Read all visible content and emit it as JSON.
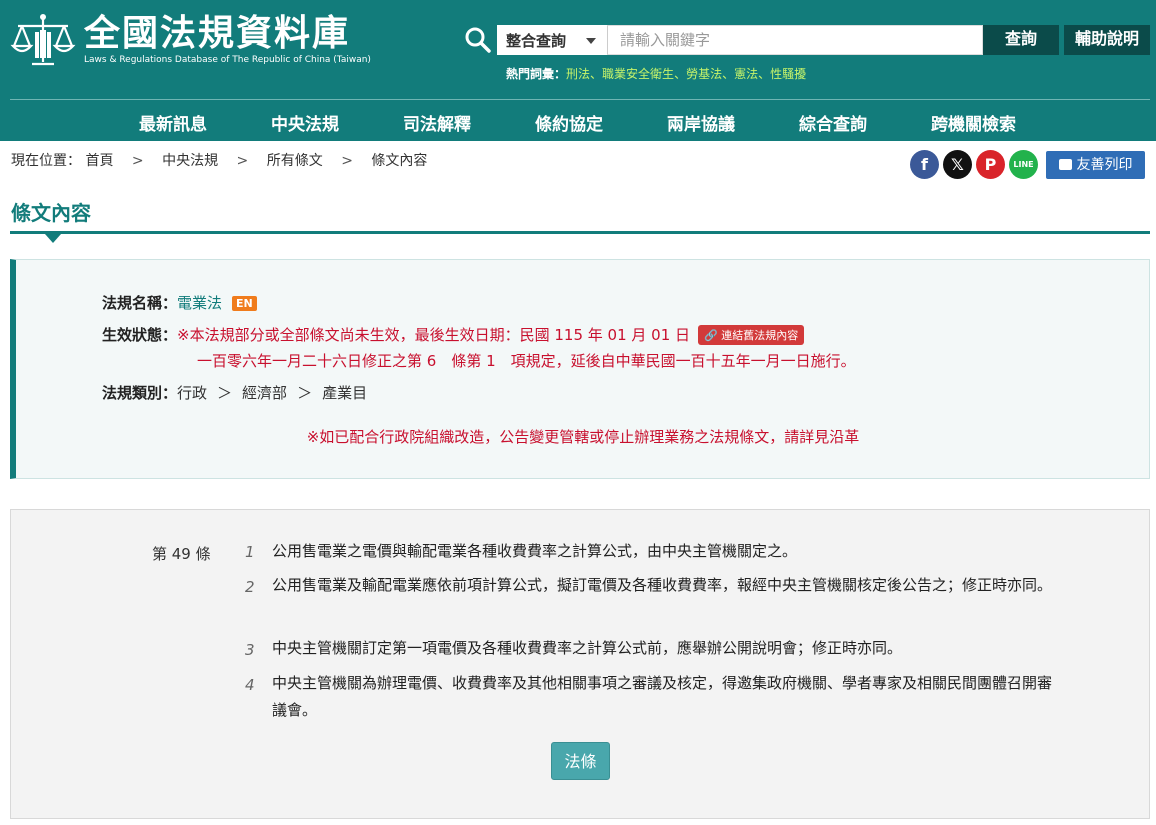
{
  "header": {
    "title": "全國法規資料庫",
    "subtitle": "Laws & Regulations Database of The Republic of China (Taiwan)",
    "search": {
      "select_value": "整合查詢",
      "placeholder": "請輸入關鍵字",
      "query_button": "查詢",
      "help_button": "輔助說明"
    },
    "hot_words": {
      "label": "熱門詞彙：",
      "items": [
        "刑法",
        "職業安全衛生",
        "勞基法",
        "憲法",
        "性騷擾"
      ],
      "separator": "、"
    }
  },
  "nav": {
    "items": [
      "最新訊息",
      "中央法規",
      "司法解釋",
      "條約協定",
      "兩岸協議",
      "綜合查詢",
      "跨機關檢索"
    ]
  },
  "breadcrumb": {
    "label": "現在位置：",
    "items": [
      "首頁",
      "中央法規",
      "所有條文",
      "條文內容"
    ],
    "separator": ">"
  },
  "share": {
    "facebook": "f",
    "x": "𝕏",
    "pinterest": "P",
    "line": "LINE",
    "print_label": "友善列印"
  },
  "page_title": "條文內容",
  "info": {
    "law_name_label": "法規名稱：",
    "law_name": "電業法",
    "en_badge": "EN",
    "status_label": "生效狀態：",
    "status_line1": "※本法規部分或全部條文尚未生效，最後生效日期：民國 115 年 01 月 01 日",
    "old_law_link": "連結舊法規內容",
    "status_line2": "一百零六年一月二十六日修正之第 6　條第 1　項規定，延後自中華民國一百十五年一月一日施行。",
    "category_label": "法規類別：",
    "category": [
      "行政",
      "經濟部",
      "產業目"
    ],
    "category_separator": "＞",
    "note": "※如已配合行政院組織改造，公告變更管轄或停止辦理業務之法規條文，請詳見沿革"
  },
  "article": {
    "number": "第 49 條",
    "paragraphs": [
      {
        "num": "1",
        "text": "公用售電業之電價與輸配電業各種收費費率之計算公式，由中央主管機關定之。"
      },
      {
        "num": "2",
        "text": "公用售電業及輸配電業應依前項計算公式，擬訂電價及各種收費費率，報經中央主管機關核定後公告之；修正時亦同。"
      },
      {
        "num": "3",
        "text": "中央主管機關訂定第一項電價及各種收費費率之計算公式前，應舉辦公開說明會；修正時亦同。"
      },
      {
        "num": "4",
        "text": "中央主管機關為辦理電價、收費費率及其他相關事項之審議及核定，得邀集政府機關、學者專家及相關民間團體召開審議會。"
      }
    ],
    "button": "法條"
  },
  "colors": {
    "brand": "#127c7b",
    "alert": "#c8102e",
    "hot_word": "#c6f36a",
    "print_button": "#2f6db6"
  }
}
